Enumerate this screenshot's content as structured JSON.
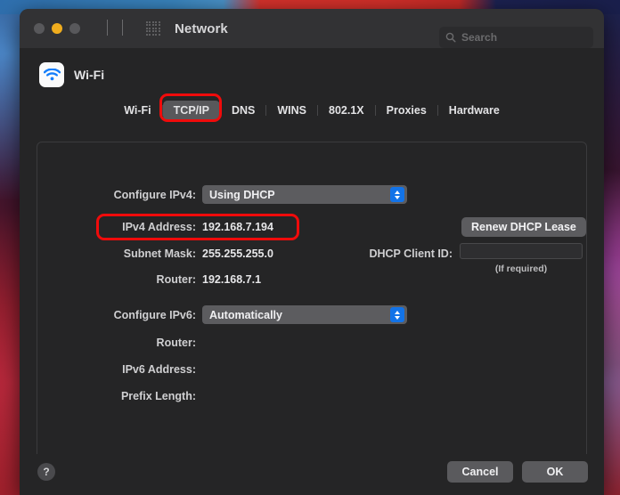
{
  "window": {
    "title": "Network",
    "traffic_lights": [
      "close-button",
      "minimize-button",
      "zoom-button"
    ],
    "back_icon": "chevron-left-icon",
    "forward_icon": "chevron-right-icon",
    "grid_icon": "grid-apps-icon"
  },
  "search": {
    "icon": "search-icon",
    "placeholder": "Search",
    "value": ""
  },
  "service": {
    "icon": "wifi-icon",
    "name": "Wi-Fi"
  },
  "tabs": [
    {
      "label": "Wi-Fi",
      "selected": false
    },
    {
      "label": "TCP/IP",
      "selected": true
    },
    {
      "label": "DNS",
      "selected": false
    },
    {
      "label": "WINS",
      "selected": false
    },
    {
      "label": "802.1X",
      "selected": false
    },
    {
      "label": "Proxies",
      "selected": false
    },
    {
      "label": "Hardware",
      "selected": false
    }
  ],
  "ipv4": {
    "configure_label": "Configure IPv4:",
    "configure_value": "Using DHCP",
    "address_label": "IPv4 Address:",
    "address_value": "192.168.7.194",
    "subnet_label": "Subnet Mask:",
    "subnet_value": "255.255.255.0",
    "router_label": "Router:",
    "router_value": "192.168.7.1"
  },
  "dhcp": {
    "renew_button": "Renew DHCP Lease",
    "client_id_label": "DHCP Client ID:",
    "client_id_value": "",
    "hint": "(If required)"
  },
  "ipv6": {
    "configure_label": "Configure IPv6:",
    "configure_value": "Automatically",
    "router_label": "Router:",
    "router_value": "",
    "address_label": "IPv6 Address:",
    "address_value": "",
    "prefix_label": "Prefix Length:",
    "prefix_value": ""
  },
  "footer": {
    "help_label": "?",
    "cancel_label": "Cancel",
    "ok_label": "OK"
  },
  "annotations": {
    "color": "#f00b0b",
    "targets": [
      "tcpip-tab",
      "ipv4-address-row"
    ]
  },
  "colors": {
    "accent_blue": "#1273e8",
    "window_bg": "#252526",
    "titlebar_bg": "#323234",
    "control_gray": "#5c5c5f",
    "minimize_yellow": "#f0ad1e"
  }
}
